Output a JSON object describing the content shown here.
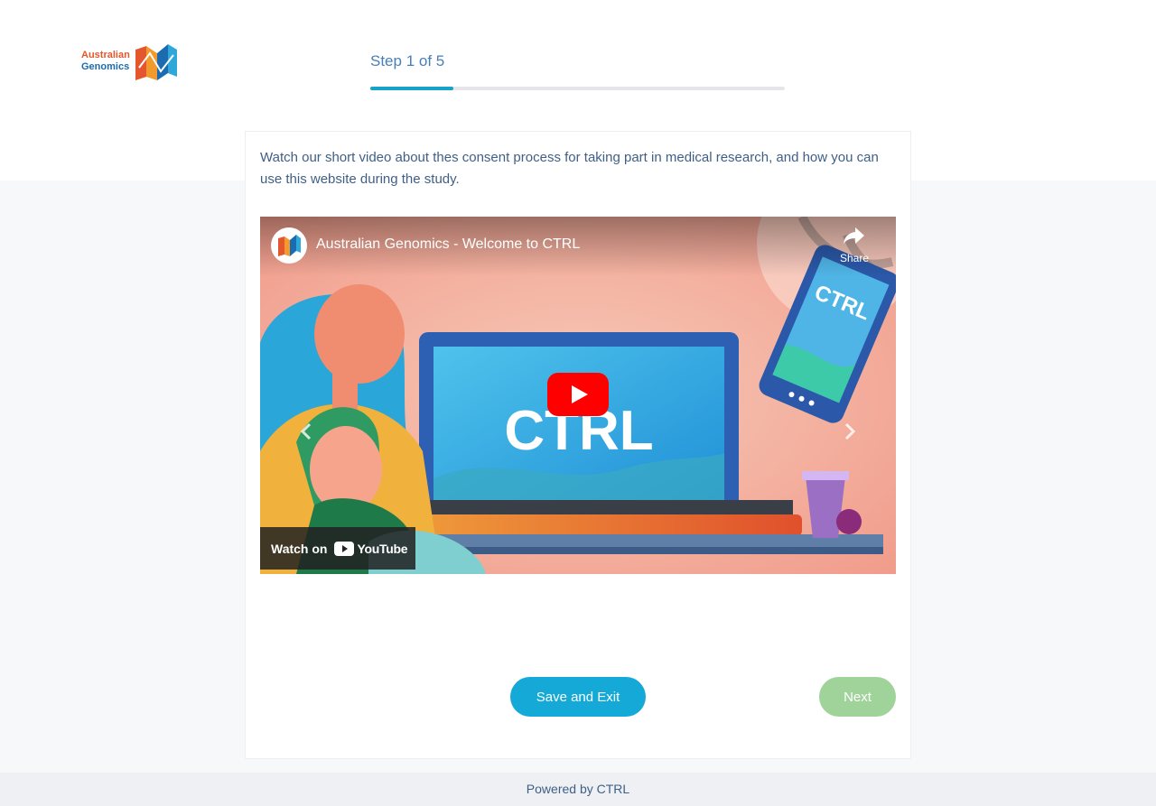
{
  "header": {
    "logo": {
      "line1": "Australian",
      "line2": "Genomics",
      "icon": "australian-genomics-logo-icon"
    },
    "step_label": "Step 1 of 5",
    "progress_fraction": 0.2
  },
  "main": {
    "intro_text": "Watch our short video about thes consent process for taking part in medical research, and how you can use this website during the study.",
    "video": {
      "title": "Australian Genomics - Welcome to CTRL",
      "share_label": "Share",
      "screen_word": "CTRL",
      "phone_word": "CTRL",
      "watch_on_label": "Watch on",
      "youtube_word": "YouTube",
      "play_icon": "play-icon",
      "prev_icon": "chevron-left-icon",
      "next_icon": "chevron-right-icon"
    },
    "buttons": {
      "save_exit": "Save and Exit",
      "next": "Next"
    }
  },
  "footer": {
    "text": "Powered by CTRL"
  },
  "colors": {
    "accent": "#14a9d6",
    "next_disabled": "#9fd39a",
    "text": "#3f5f86",
    "youtube_red": "#ff0000"
  }
}
